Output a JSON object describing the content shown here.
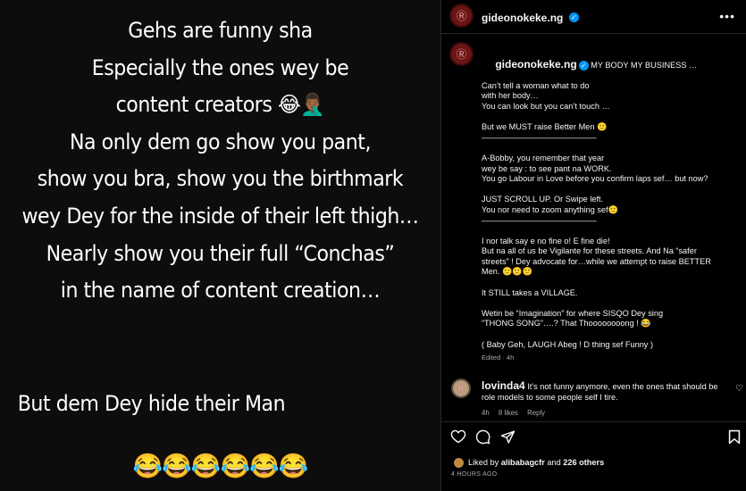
{
  "image": {
    "lines": [
      "Gehs are funny sha",
      "Especially the ones wey be",
      "content creators 😂🤦🏾‍♂️",
      "Na only dem go show you pant,",
      "show you bra, show you the birthmark",
      "wey Dey for the inside of their left thigh…",
      "Nearly show you their full  “Conchas”",
      "in the name of content creation…"
    ],
    "bottom_line": "But dem Dey hide their Man",
    "emoji_row": "😂😂😂😂😂😂"
  },
  "header": {
    "username": "gideonokeke.ng",
    "more": "•••"
  },
  "caption": {
    "username": "gideonokeke.ng",
    "lines": [
      "MY BODY MY BUSINESS …",
      "Can’t tell a woman what to do",
      "with her body…",
      "You can look but you can’t touch …",
      "",
      "But we MUST raise Better Men 🙂",
      "——————————————",
      "",
      "A-Bobby, you remember that year",
      "wey be say : to see pant na WORK.",
      "You go Labour in Love before you confirm laps sef… but now?",
      "",
      "JUST SCROLL UP. Or Swipe left.",
      "You nor need to zoom anything sef🙂",
      "——————————————",
      "",
      "I nor talk say e no fine o! E fine die!",
      "But na all of us be Vigilante for these streets. And Na “safer",
      "streets” ! Dey advocate for…while we attempt to raise BETTER",
      "Men. 🙂🙂🙂",
      "",
      "It STILL takes a VILLAGE.",
      "",
      "Wetin be “Imagination” for where SISQO Dey sing",
      "“THONG SONG”….? That Thoooooooong ! 😂",
      "",
      "( Baby Geh, LAUGH Abeg ! D thing sef Funny )"
    ],
    "edited": "Edited · 4h"
  },
  "comment": {
    "username": "lovinda4",
    "text": "It's not funny anymore, even the ones that should be role models to some people self I tire.",
    "time": "4h",
    "likes": "8 likes",
    "reply": "Reply"
  },
  "likes": {
    "prefix": "Liked by ",
    "user": "alibabagcfr",
    "middle": " and ",
    "others": "226 others"
  },
  "timestamp": "4 HOURS AGO"
}
